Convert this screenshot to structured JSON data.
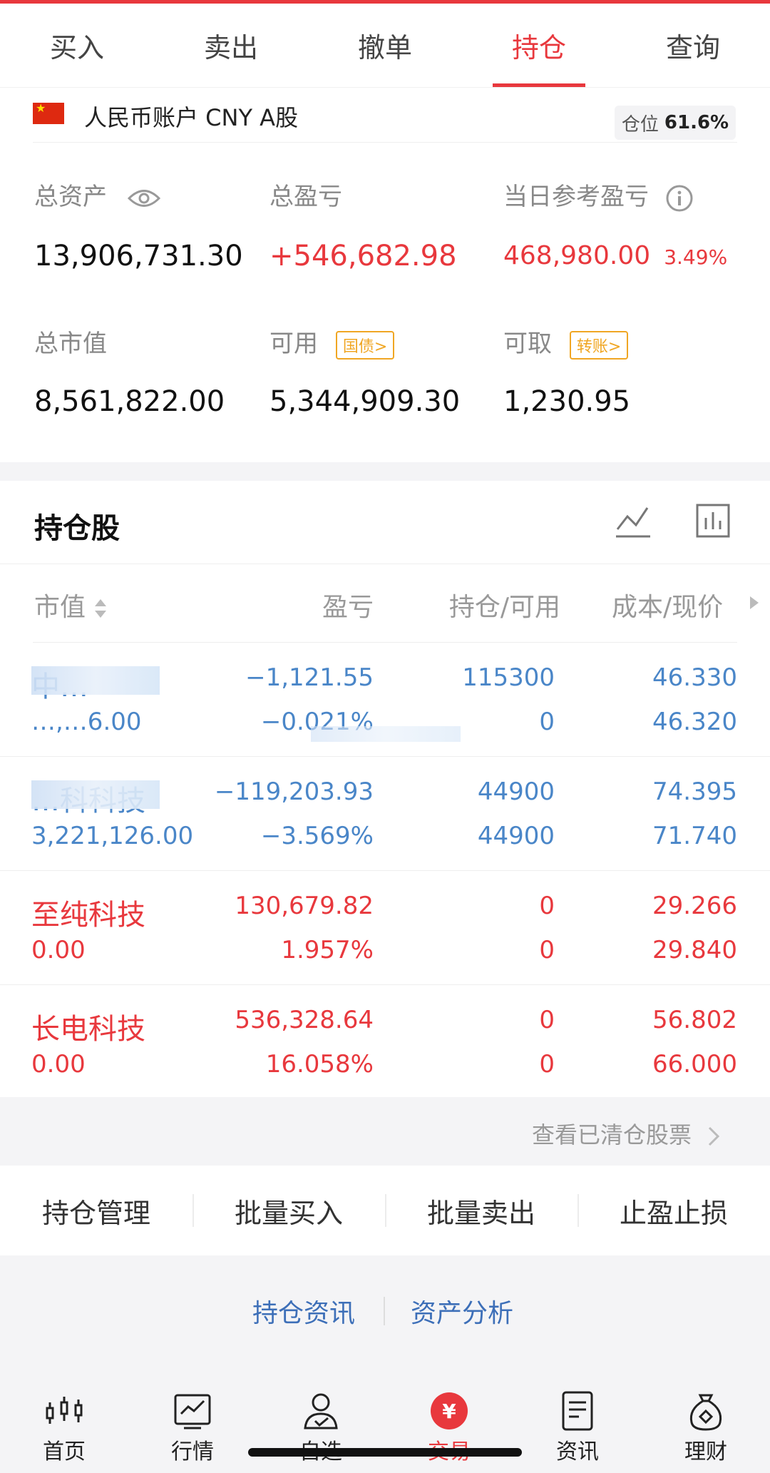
{
  "tabs": [
    "买入",
    "卖出",
    "撤单",
    "持仓",
    "查询"
  ],
  "active_tab": "持仓",
  "account": {
    "label": "人民币账户 CNY A股",
    "position_label": "仓位",
    "position_value": "61.6%"
  },
  "summary": {
    "total_assets_label": "总资产",
    "total_assets": "13,906,731.30",
    "total_pnl_label": "总盈亏",
    "total_pnl": "+546,682.98",
    "daily_pnl_label": "当日参考盈亏",
    "daily_pnl": "468,980.00",
    "daily_pnl_pct": "3.49%",
    "market_value_label": "总市值",
    "market_value": "8,561,822.00",
    "available_label": "可用",
    "available_tag": "国债>",
    "available": "5,344,909.30",
    "withdrawable_label": "可取",
    "withdrawable_tag": "转账>",
    "withdrawable": "1,230.95"
  },
  "holdings": {
    "title": "持仓股",
    "columns": [
      "市值",
      "盈亏",
      "持仓/可用",
      "成本/现价"
    ],
    "rows": [
      {
        "name": "中…",
        "market_value": "…,…6.00",
        "pnl": "−1,121.55",
        "pnl_pct": "−0.021%",
        "hold": "115300",
        "avail": "0",
        "cost": "46.330",
        "price": "46.320",
        "color": "#4a86c8"
      },
      {
        "name": "…科科技",
        "market_value": "3,221,126.00",
        "pnl": "−119,203.93",
        "pnl_pct": "−3.569%",
        "hold": "44900",
        "avail": "44900",
        "cost": "74.395",
        "price": "71.740",
        "color": "#4a86c8"
      },
      {
        "name": "至纯科技",
        "market_value": "0.00",
        "pnl": "130,679.82",
        "pnl_pct": "1.957%",
        "hold": "0",
        "avail": "0",
        "cost": "29.266",
        "price": "29.840",
        "color": "#e8383d"
      },
      {
        "name": "长电科技",
        "market_value": "0.00",
        "pnl": "536,328.64",
        "pnl_pct": "16.058%",
        "hold": "0",
        "avail": "0",
        "cost": "56.802",
        "price": "66.000",
        "color": "#e8383d"
      }
    ],
    "view_cleared": "查看已清仓股票"
  },
  "actions": [
    "持仓管理",
    "批量买入",
    "批量卖出",
    "止盈止损"
  ],
  "links": {
    "news": "持仓资讯",
    "analysis": "资产分析"
  },
  "nav": {
    "items": [
      {
        "label": "首页",
        "icon": "home-chart-icon"
      },
      {
        "label": "行情",
        "icon": "market-icon"
      },
      {
        "label": "自选",
        "icon": "watchlist-icon"
      },
      {
        "label": "交易",
        "icon": "trade-yuan-icon"
      },
      {
        "label": "资讯",
        "icon": "news-icon"
      },
      {
        "label": "理财",
        "icon": "wealth-icon"
      }
    ],
    "active": "交易"
  },
  "colors": {
    "accent": "#e8383d",
    "gain": "#e8383d",
    "loss": "#4a86c8",
    "tag": "#f0a623"
  }
}
